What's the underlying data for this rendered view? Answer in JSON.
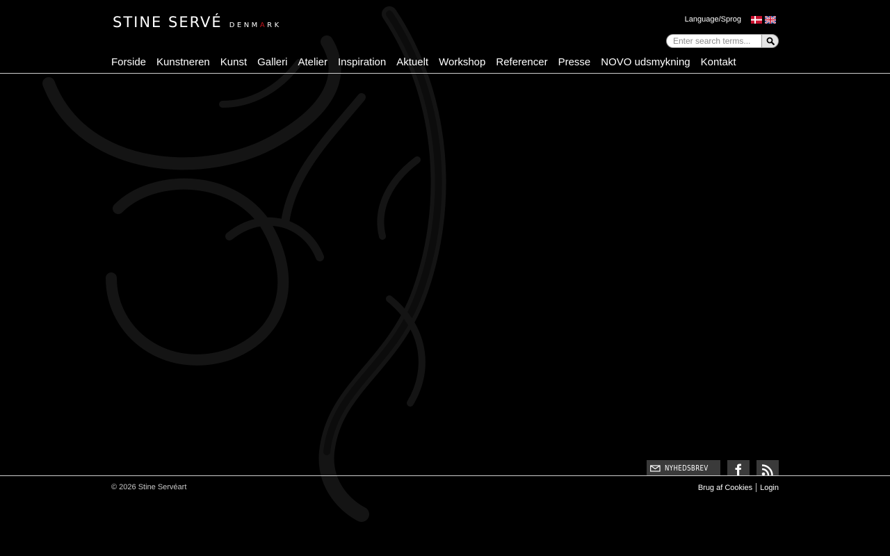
{
  "header": {
    "logo": {
      "name": "STINE SERVÉ",
      "sub_before": "DENM",
      "sub_accent": "A",
      "sub_after": "RK"
    },
    "language_label": "Language/Sprog",
    "flags": [
      {
        "icon": "danish-flag-icon"
      },
      {
        "icon": "uk-flag-icon"
      }
    ],
    "search": {
      "placeholder": "Enter search terms...",
      "button_icon": "search-icon"
    }
  },
  "nav": {
    "items": [
      {
        "label": "Forside"
      },
      {
        "label": "Kunstneren"
      },
      {
        "label": "Kunst"
      },
      {
        "label": "Galleri"
      },
      {
        "label": "Atelier"
      },
      {
        "label": "Inspiration"
      },
      {
        "label": "Aktuelt"
      },
      {
        "label": "Workshop"
      },
      {
        "label": "Referencer"
      },
      {
        "label": "Presse"
      },
      {
        "label": "NOVO udsmykning"
      },
      {
        "label": "Kontakt"
      }
    ]
  },
  "social": {
    "newsletter_label": "NYHEDSBREV",
    "newsletter_icon": "mail-icon",
    "facebook_icon": "facebook-icon",
    "rss_icon": "rss-icon"
  },
  "footer": {
    "copyright": "© 2026 Stine Servéart",
    "links": [
      {
        "label": "Brug af Cookies"
      },
      {
        "label": "Login"
      }
    ]
  },
  "colors": {
    "background": "#000000",
    "accent": "#c0141c",
    "divider": "#cfcfcf",
    "button_bg": "#3a3a3a"
  }
}
